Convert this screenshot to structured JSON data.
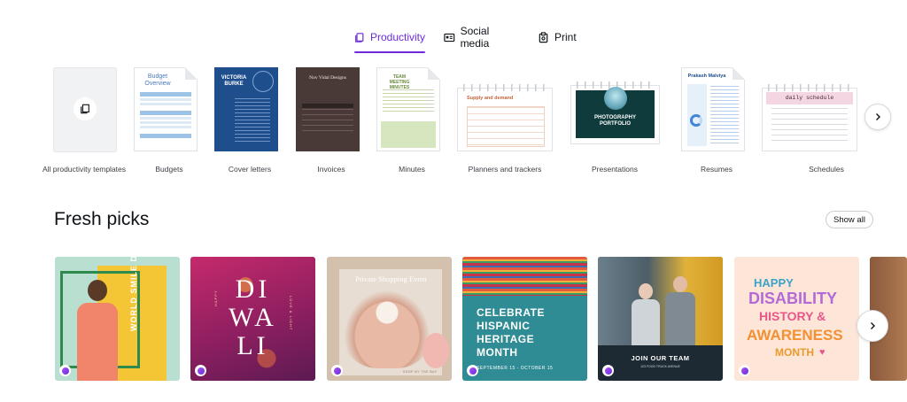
{
  "tabs": [
    {
      "label": "Productivity",
      "active": true,
      "icon": "document-stack-icon"
    },
    {
      "label": "Social media",
      "active": false,
      "icon": "social-feed-icon"
    },
    {
      "label": "Print",
      "active": false,
      "icon": "print-icon"
    }
  ],
  "categories": [
    {
      "label": "All productivity templates",
      "icon": "stack-icon"
    },
    {
      "label": "Budgets",
      "thumb_title": "Budget Overview"
    },
    {
      "label": "Cover letters",
      "thumb_title": "VICTORIA BURKE"
    },
    {
      "label": "Invoices",
      "thumb_title": "Nov Vidal Designs"
    },
    {
      "label": "Minutes",
      "thumb_title": "TEAM MEETING MINUTES"
    },
    {
      "label": "Planners and trackers",
      "thumb_title": "Supply and demand"
    },
    {
      "label": "Presentations",
      "thumb_title": "PHOTOGRAPHY PORTFOLIO"
    },
    {
      "label": "Resumes",
      "thumb_title": "Prakash Malviya"
    },
    {
      "label": "Schedules",
      "thumb_title": "daily schedule"
    }
  ],
  "fresh_picks": {
    "title": "Fresh picks",
    "show_all_label": "Show all",
    "cards": [
      {
        "name": "world-smile-day",
        "text": "WORLD SMILE DAY"
      },
      {
        "name": "diwali",
        "text": "DIWALI",
        "letters": [
          "DI",
          "WA",
          "LI"
        ],
        "side_left": "HAPPY",
        "side_right": "LOVE & LIGHT"
      },
      {
        "name": "private-shopping",
        "text": "Private Shopping Event",
        "small": "SHOP BY THE BAY"
      },
      {
        "name": "hispanic-heritage",
        "lines": [
          "CELEBRATE",
          "HISPANIC",
          "HERITAGE",
          "MONTH"
        ],
        "small": "SEPTEMBER 15 - OCTOBER 15"
      },
      {
        "name": "join-our-team",
        "text": "JOIN OUR TEAM",
        "small": "123 FOOD TRUCK AVENUE"
      },
      {
        "name": "disability-awareness",
        "lines": [
          "HAPPY",
          "DISABILITY",
          "HISTORY &",
          "AWARENESS",
          "MONTH"
        ]
      }
    ]
  },
  "colors": {
    "accent": "#6c2bd9",
    "text": "#0e1318"
  }
}
